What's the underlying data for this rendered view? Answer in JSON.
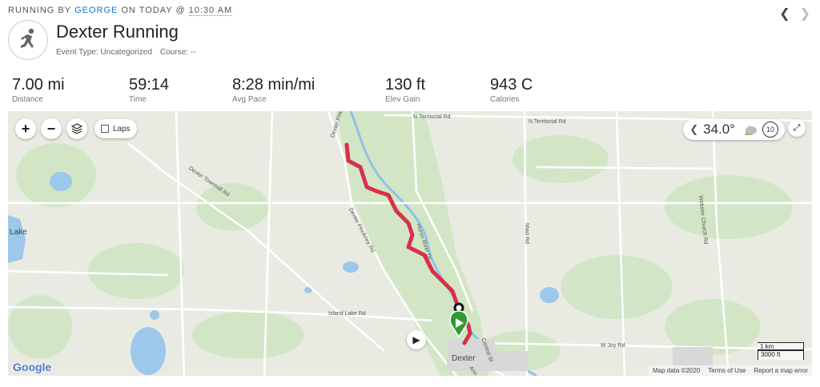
{
  "header": {
    "prefix": "RUNNING BY",
    "user": "GEORGE",
    "on_today": "ON TODAY @",
    "time": "10:30 AM",
    "title": "Dexter Running",
    "event_type": "Event Type: Uncategorized",
    "course": "Course: --",
    "prev_icon": "chevron-left-icon",
    "next_icon": "chevron-right-icon",
    "activity_icon": "runner-icon"
  },
  "stats": [
    {
      "value": "7.00 mi",
      "label": "Distance"
    },
    {
      "value": "59:14",
      "label": "Time"
    },
    {
      "value": "8:28 min/mi",
      "label": "Avg Pace"
    },
    {
      "value": "130 ft",
      "label": "Elev Gain"
    },
    {
      "value": "943 C",
      "label": "Calories"
    }
  ],
  "map": {
    "zoom_in": "+",
    "zoom_out": "−",
    "laps_label": "Laps",
    "temperature": "34.0°",
    "wind_speed": "10",
    "route_color": "#d9304a",
    "start_marker_color": "#2e9c2e",
    "roads": {
      "n_territorial_1": "N Territorial Rd",
      "n_territorial_2": "N Territorial Rd",
      "dexter_pinckney_1": "Dexter Pinckney Rd",
      "dexter_pinckney_2": "Dexter Pinckney Rd",
      "dexter_townhall": "Dexter Townhall Rd",
      "huron_river": "Huron River Dr",
      "mast": "Mast Rd",
      "webster_church": "Webster Church Rd",
      "island_lake": "Island Lake Rd",
      "w_joy": "W Joy Rd",
      "central": "Central St",
      "ann_arbor": "Ann A"
    },
    "places": {
      "lake": "Lake",
      "dexter": "Dexter"
    },
    "google_logo": "Google",
    "footer": {
      "map_data": "Map data ©2020",
      "terms": "Terms of Use",
      "report": "Report a map error"
    },
    "scale": {
      "metric": "1 km",
      "imperial": "3000 ft"
    }
  }
}
